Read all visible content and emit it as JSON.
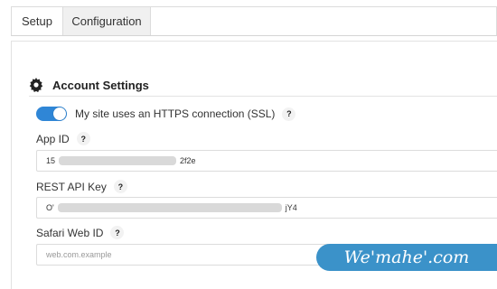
{
  "tabs": [
    {
      "label": "Setup",
      "active": false
    },
    {
      "label": "Configuration",
      "active": true
    }
  ],
  "section": {
    "title": "Account Settings",
    "icon": "gear-icon"
  },
  "https_toggle": {
    "label": "My site uses an HTTPS connection (SSL)",
    "on": true,
    "help": "?"
  },
  "fields": {
    "app_id": {
      "label": "App ID",
      "help": "?",
      "value": "15",
      "value_tail": "2f2e"
    },
    "rest_api_key": {
      "label": "REST API Key",
      "help": "?",
      "value": "O'",
      "value_tail": "jY4"
    },
    "safari_web_id": {
      "label": "Safari Web ID",
      "help": "?",
      "placeholder": "web.com.example"
    }
  },
  "watermark": "We'mahe'.com",
  "colors": {
    "accent": "#2f86d6",
    "watermark_bg": "#3b92c9"
  }
}
